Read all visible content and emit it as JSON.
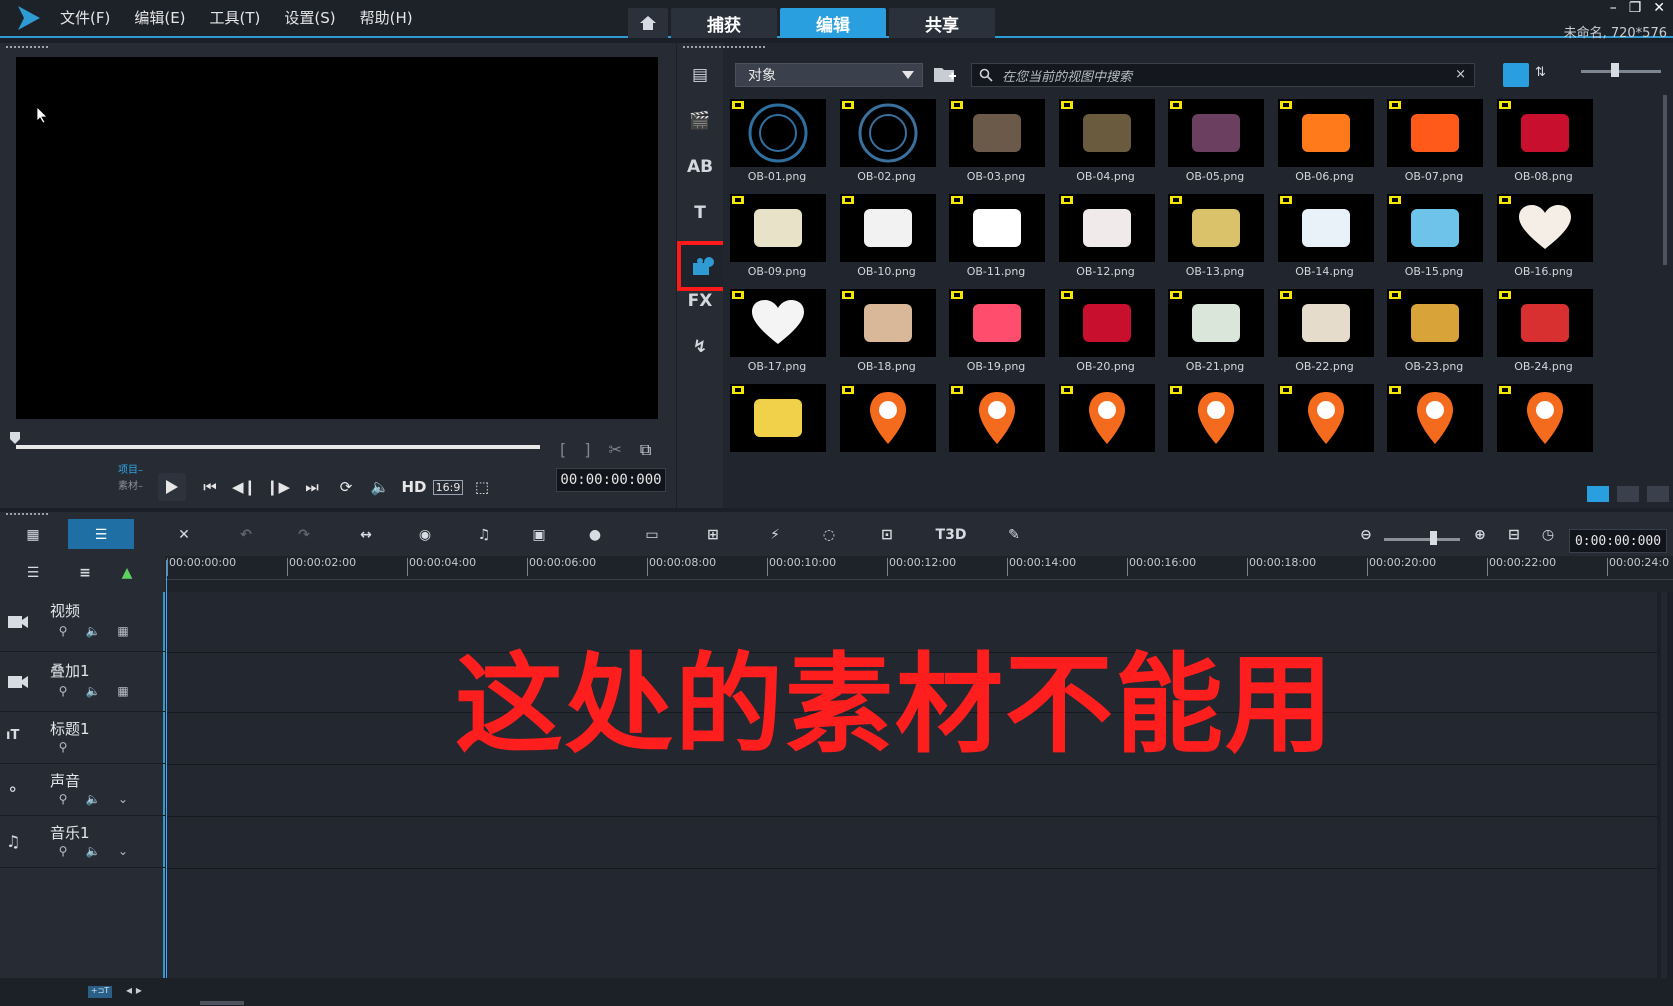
{
  "menu": [
    "文件(F)",
    "编辑(E)",
    "工具(T)",
    "设置(S)",
    "帮助(H)"
  ],
  "tabs": {
    "capture": "捕获",
    "edit": "编辑",
    "share": "共享"
  },
  "project_info": "未命名, 720*576",
  "window_controls": [
    "–",
    "❐",
    "✕"
  ],
  "player": {
    "mode_project": "项目–",
    "mode_clip": "素材–",
    "hd_label": "HD",
    "ratio_label": "16:9",
    "timecode": "00:00:00:000"
  },
  "library": {
    "category": "对象",
    "search_placeholder": "在您当前的视图中搜索",
    "items": [
      "OB-01.png",
      "OB-02.png",
      "OB-03.png",
      "OB-04.png",
      "OB-05.png",
      "OB-06.png",
      "OB-07.png",
      "OB-08.png",
      "OB-09.png",
      "OB-10.png",
      "OB-11.png",
      "OB-12.png",
      "OB-13.png",
      "OB-14.png",
      "OB-15.png",
      "OB-16.png",
      "OB-17.png",
      "OB-18.png",
      "OB-19.png",
      "OB-20.png",
      "OB-21.png",
      "OB-22.png",
      "OB-23.png",
      "OB-24.png",
      "",
      "",
      "",
      "",
      "",
      "",
      "",
      ""
    ],
    "side_fx_label": "FX"
  },
  "timeline": {
    "timecode": "0:00:00:000",
    "ruler": [
      "00:00:00:00",
      "00:00:02:00",
      "00:00:04:00",
      "00:00:06:00",
      "00:00:08:00",
      "00:00:10:00",
      "00:00:12:00",
      "00:00:14:00",
      "00:00:16:00",
      "00:00:18:00",
      "00:00:20:00",
      "00:00:22:00",
      "00:00:24:0"
    ],
    "tracks": [
      "视频",
      "叠加1",
      "标题1",
      "声音",
      "音乐1"
    ],
    "t3d_label": "T3D"
  },
  "overlay_text": "这处的素材不能用",
  "colors": {
    "accent": "#2a9fe0",
    "highlight": "#ff1a1a"
  }
}
